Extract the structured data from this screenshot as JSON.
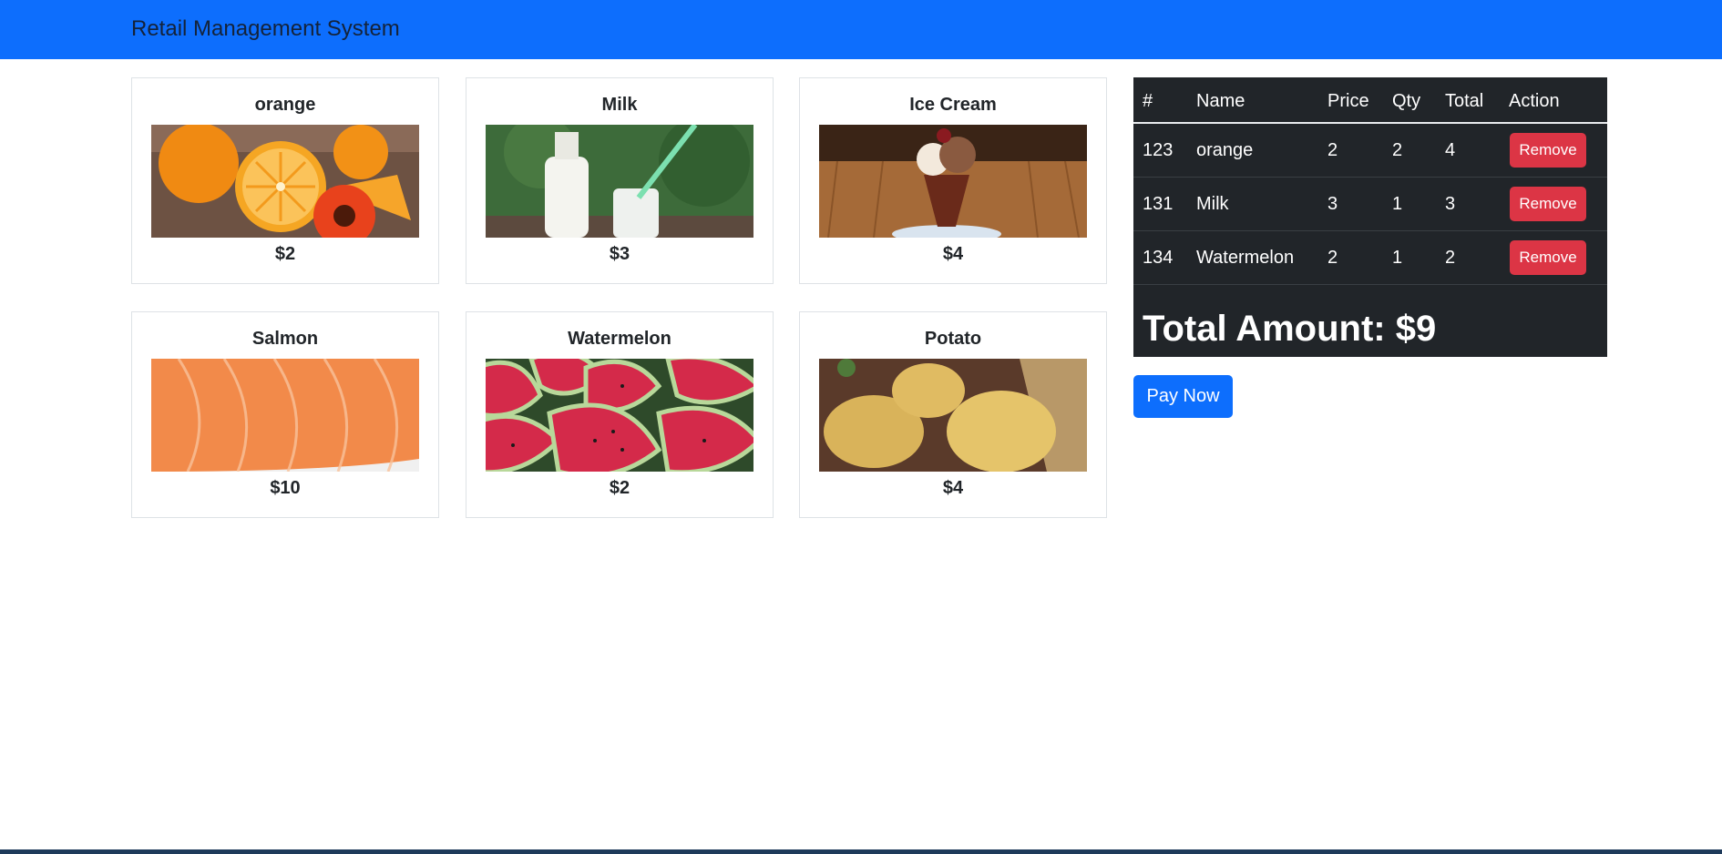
{
  "navbar": {
    "brand": "Retail Management System"
  },
  "products": [
    {
      "name": "orange",
      "price": "$2",
      "image": "orange-image"
    },
    {
      "name": "Milk",
      "price": "$3",
      "image": "milk-image"
    },
    {
      "name": "Ice Cream",
      "price": "$4",
      "image": "ice-cream-image"
    },
    {
      "name": "Salmon",
      "price": "$10",
      "image": "salmon-image"
    },
    {
      "name": "Watermelon",
      "price": "$2",
      "image": "watermelon-image"
    },
    {
      "name": "Potato",
      "price": "$4",
      "image": "potato-image"
    }
  ],
  "cart": {
    "headers": {
      "id": "#",
      "name": "Name",
      "price": "Price",
      "qty": "Qty",
      "total": "Total",
      "action": "Action"
    },
    "rows": [
      {
        "id": "123",
        "name": "orange",
        "price": "2",
        "qty": "2",
        "total": "4",
        "action": "Remove"
      },
      {
        "id": "131",
        "name": "Milk",
        "price": "3",
        "qty": "1",
        "total": "3",
        "action": "Remove"
      },
      {
        "id": "134",
        "name": "Watermelon",
        "price": "2",
        "qty": "1",
        "total": "2",
        "action": "Remove"
      }
    ],
    "total_amount": "Total Amount: $9"
  },
  "pay_button": "Pay Now",
  "colors": {
    "primary": "#0d6efd",
    "danger": "#dc3545",
    "table_dark": "#212529"
  }
}
